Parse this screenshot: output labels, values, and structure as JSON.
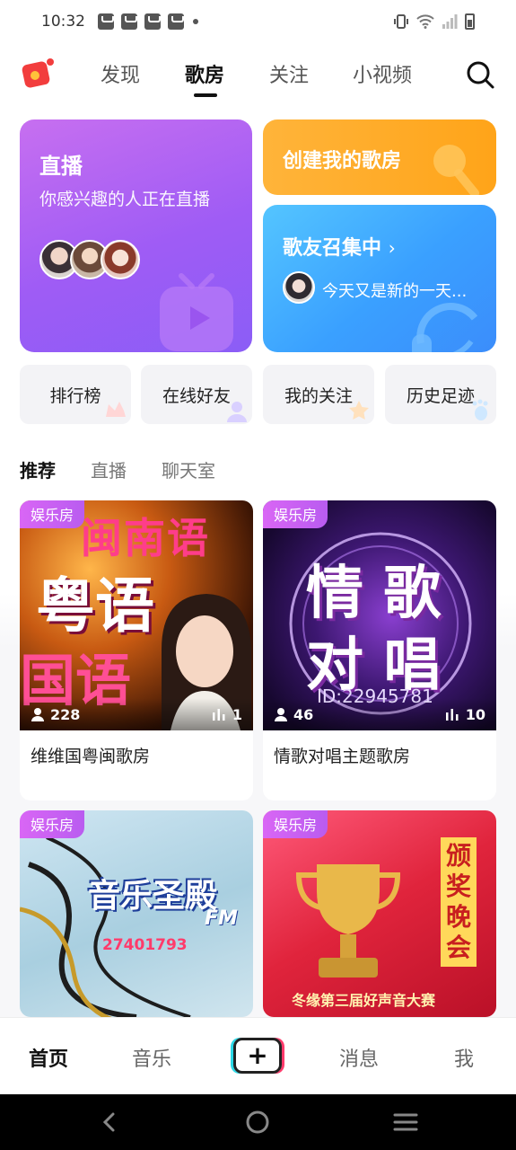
{
  "status_bar": {
    "time": "10:32",
    "notification_count": 4
  },
  "top_nav": {
    "tabs": [
      {
        "label": "发现",
        "active": false
      },
      {
        "label": "歌房",
        "active": true
      },
      {
        "label": "关注",
        "active": false
      },
      {
        "label": "小视频",
        "active": false
      }
    ]
  },
  "live_card": {
    "title": "直播",
    "subtitle": "你感兴趣的人正在直播"
  },
  "create_card": {
    "title": "创建我的歌房"
  },
  "gather_card": {
    "title": "歌友召集中",
    "chevron": "›",
    "message": "今天又是新的一天..."
  },
  "quick_links": [
    {
      "label": "排行榜"
    },
    {
      "label": "在线好友"
    },
    {
      "label": "我的关注"
    },
    {
      "label": "历史足迹"
    }
  ],
  "sub_tabs": [
    {
      "label": "推荐",
      "active": true
    },
    {
      "label": "直播",
      "active": false
    },
    {
      "label": "聊天室",
      "active": false
    }
  ],
  "rooms": [
    {
      "tag": "娱乐房",
      "users": "228",
      "mics": "1",
      "name": "维维国粤闽歌房",
      "cover_text": [
        "闽南语",
        "粤语",
        "国语"
      ]
    },
    {
      "tag": "娱乐房",
      "users": "46",
      "mics": "10",
      "name": "情歌对唱主题歌房",
      "cover_text": [
        "情 歌",
        "对 唱",
        "ID:22945781"
      ]
    },
    {
      "tag": "娱乐房",
      "users": "",
      "mics": "",
      "name": "",
      "cover_text": [
        "音乐圣殿",
        "FM",
        "27401793"
      ]
    },
    {
      "tag": "娱乐房",
      "users": "",
      "mics": "",
      "name": "",
      "cover_text": [
        "颁奖晚会",
        "冬缘第三届好声音大赛"
      ]
    }
  ],
  "bottom_nav": {
    "items": [
      {
        "label": "首页",
        "active": true
      },
      {
        "label": "音乐",
        "active": false
      },
      {
        "label": "+",
        "active": false
      },
      {
        "label": "消息",
        "active": false
      },
      {
        "label": "我",
        "active": false
      }
    ]
  },
  "colors": {
    "accent": "#9f5cf5",
    "orange": "#ffa419",
    "blue": "#3aa0ff",
    "tag": "#d966f5"
  }
}
